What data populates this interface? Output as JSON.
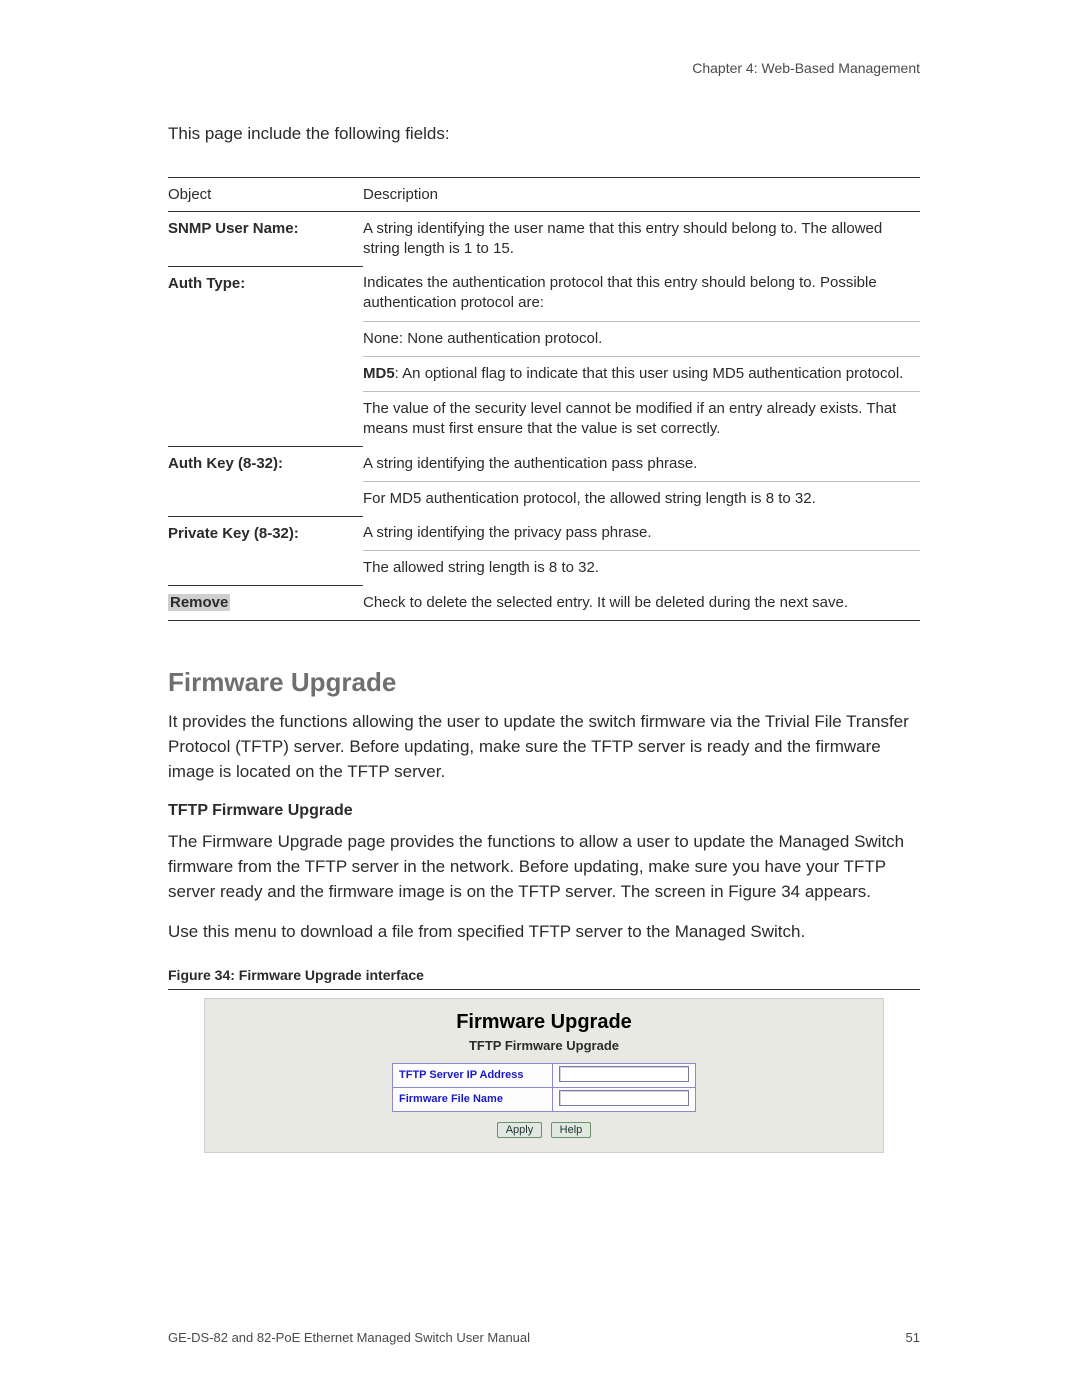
{
  "chapter": "Chapter 4: Web-Based Management",
  "intro": "This page include the following fields:",
  "table": {
    "headers": {
      "object": "Object",
      "description": "Description"
    },
    "rows": [
      {
        "object": "SNMP User Name:",
        "descs": [
          "A string identifying the user name that this entry should belong to. The allowed string length is 1 to 15."
        ]
      },
      {
        "object": "Auth Type:",
        "descs": [
          "Indicates the authentication protocol that this entry should belong to. Possible authentication protocol are:",
          "None: None authentication protocol.",
          {
            "boldLead": "MD5",
            "rest": ": An optional flag to indicate that this user using MD5 authentication protocol."
          },
          "The value of the security level cannot be modified if an entry already exists. That means must first ensure that the value is set correctly."
        ]
      },
      {
        "object": "Auth Key (8-32):",
        "descs": [
          "A string identifying the authentication pass phrase.",
          "For MD5 authentication protocol, the allowed string length is 8 to 32."
        ]
      },
      {
        "object": "Private Key (8-32):",
        "descs": [
          "A string identifying the privacy pass phrase.",
          "The allowed string length is 8 to 32."
        ]
      },
      {
        "object": "Remove",
        "highlight": true,
        "descs": [
          "Check to delete the selected entry. It will be deleted during the next save."
        ]
      }
    ]
  },
  "section": {
    "title": "Firmware Upgrade",
    "p1": "It provides the functions allowing the user to update the switch firmware via the Trivial File Transfer Protocol (TFTP) server. Before updating, make sure the TFTP server is ready and the firmware image is located on the TFTP server.",
    "sub": "TFTP Firmware Upgrade",
    "p2": "The Firmware Upgrade page provides the functions to allow a user to update the Managed Switch firmware from the TFTP server in the network. Before updating, make sure you have your TFTP server ready and the firmware image is on the TFTP server. The screen in Figure 34 appears.",
    "p3": "Use this menu to download a file from specified TFTP server to the Managed Switch.",
    "fig_caption": "Figure 34:  Firmware Upgrade interface"
  },
  "figure": {
    "title": "Firmware Upgrade",
    "sub": "TFTP Firmware Upgrade",
    "rows": [
      {
        "label": "TFTP Server IP Address"
      },
      {
        "label": "Firmware File Name"
      }
    ],
    "buttons": {
      "apply": "Apply",
      "help": "Help"
    }
  },
  "footer": {
    "left": "GE-DS-82 and 82-PoE Ethernet Managed Switch User Manual",
    "right": "51"
  }
}
